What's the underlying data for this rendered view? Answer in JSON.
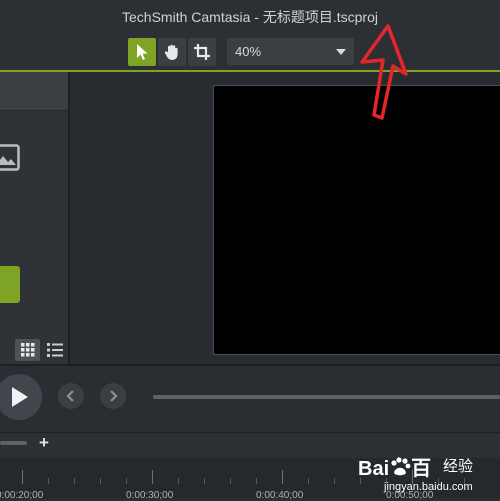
{
  "window": {
    "title": "TechSmith Camtasia - 无标题项目.tscproj"
  },
  "toolbar": {
    "tools": [
      {
        "name": "select",
        "icon": "pointer-icon",
        "active": true
      },
      {
        "name": "pan",
        "icon": "hand-icon",
        "active": false
      },
      {
        "name": "crop",
        "icon": "crop-icon",
        "active": false
      }
    ],
    "zoom": {
      "value": "40%",
      "icon": "caret-down-icon"
    }
  },
  "colors": {
    "accent": "#7fa324",
    "arrow": "#e5262a",
    "canvas": "#000000",
    "panel": "#2f3337"
  },
  "left_panel": {
    "icons": [
      "image-icon",
      "grid-view-icon",
      "list-view-icon"
    ]
  },
  "playback": {
    "icons": [
      "play-icon",
      "chevron-left-icon",
      "chevron-right-icon"
    ]
  },
  "timeline": {
    "add_label": "+",
    "labels": [
      "0:00:20;00",
      "0:00:30;00",
      "0:00:40;00",
      "0:00:50;00"
    ]
  },
  "watermark": {
    "logo": "Bai",
    "logo_tail": "百",
    "brand": "经验",
    "domain": "jingyan.baidu.com"
  }
}
